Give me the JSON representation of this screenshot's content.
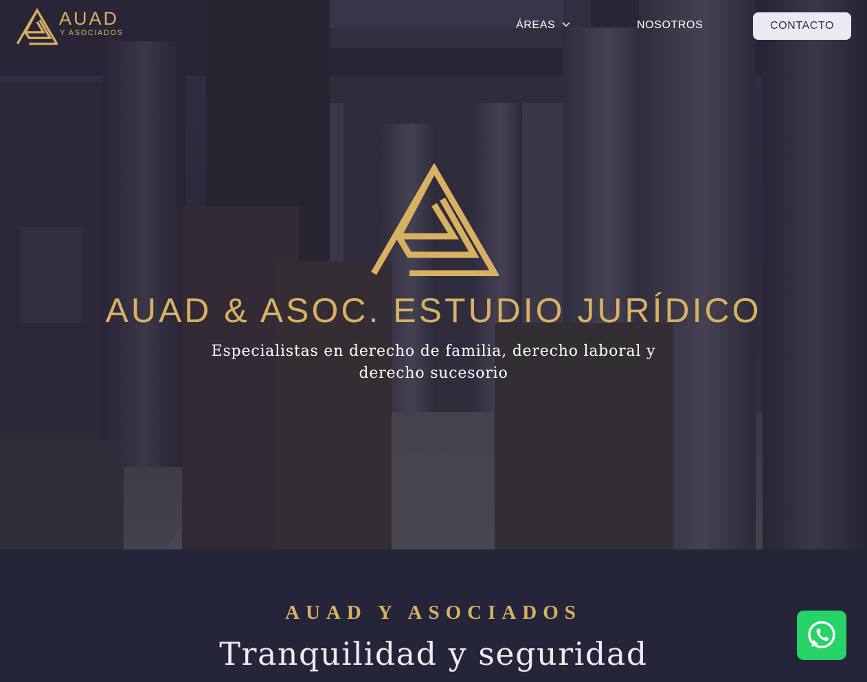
{
  "header": {
    "logo_word": "AUAD",
    "logo_sub": "Y ASOCIADOS",
    "nav": {
      "areas": "ÁREAS",
      "nosotros": "NOSOTROS",
      "contacto": "CONTACTO"
    }
  },
  "hero": {
    "title": "AUAD & ASOC. ESTUDIO JURÍDICO",
    "subtitle": "Especialistas en derecho de familia, derecho laboral y derecho sucesorio"
  },
  "section": {
    "eyebrow": "AUAD Y ASOCIADOS",
    "title": "Tranquilidad y seguridad"
  },
  "icons": {
    "logo": "triangle-a-logo-icon",
    "areas_dropdown": "chevron-down-icon",
    "whatsapp": "whatsapp-icon"
  },
  "colors": {
    "accent_gold": "#d8b062",
    "dark_navy": "#25253a",
    "contact_button_bg": "#eaeaf1",
    "contact_button_text": "#2c2f52",
    "whatsapp_green": "#25d366"
  }
}
